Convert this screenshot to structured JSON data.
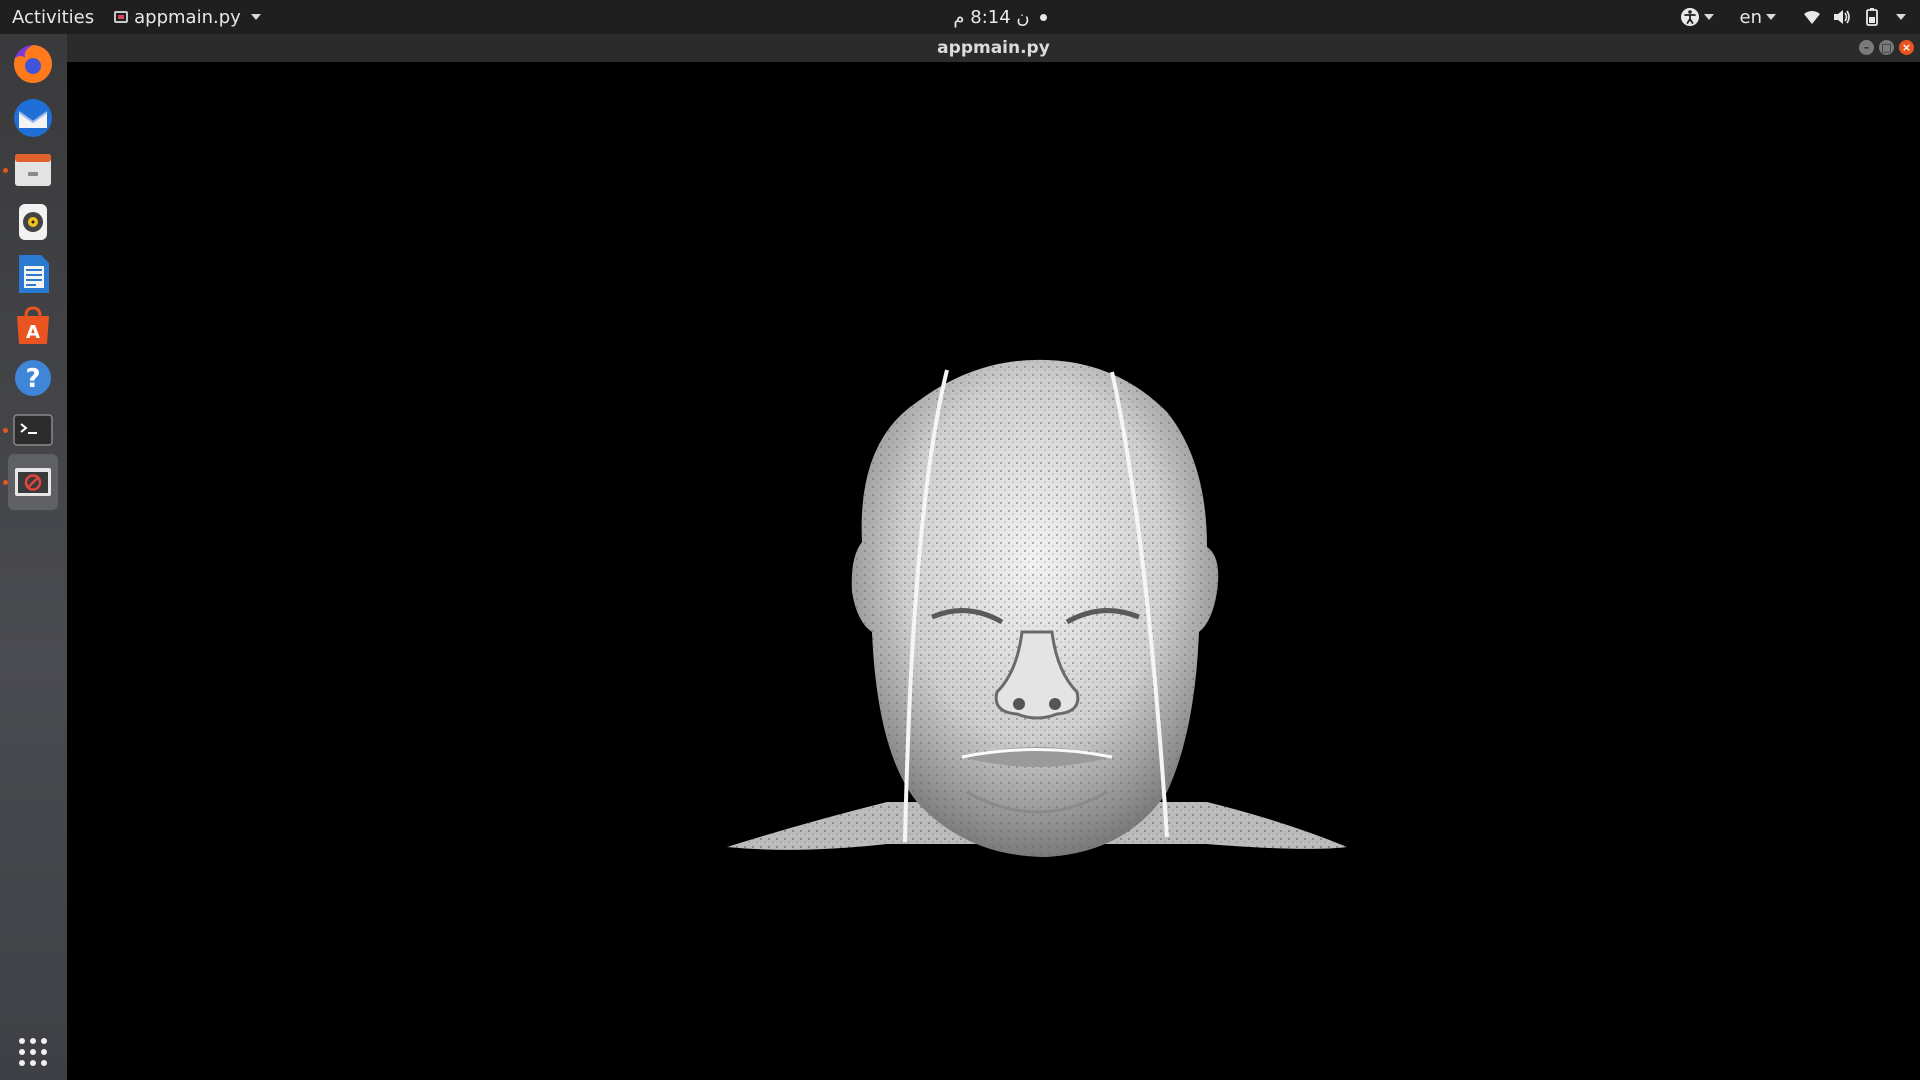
{
  "topbar": {
    "activities": "Activities",
    "app_menu_label": "appmain.py",
    "clock": "ن 8:14 م",
    "language": "en",
    "icons": {
      "accessibility": "accessibility-icon",
      "network": "wifi-icon",
      "volume": "volume-icon",
      "battery": "battery-icon"
    }
  },
  "dock": {
    "items": [
      {
        "name": "Firefox",
        "icon": "firefox-icon",
        "running": false
      },
      {
        "name": "Thunderbird",
        "icon": "thunderbird-icon",
        "running": false
      },
      {
        "name": "Files",
        "icon": "files-icon",
        "running": true
      },
      {
        "name": "Rhythmbox",
        "icon": "rhythmbox-icon",
        "running": false
      },
      {
        "name": "LibreOffice Writer",
        "icon": "writer-icon",
        "running": false
      },
      {
        "name": "Ubuntu Software",
        "icon": "software-icon",
        "running": false
      },
      {
        "name": "Help",
        "icon": "help-icon",
        "running": false
      },
      {
        "name": "Terminal",
        "icon": "terminal-icon",
        "running": true
      },
      {
        "name": "appmain.py",
        "icon": "app-window-icon",
        "running": true
      }
    ],
    "show_apps": "grid-icon"
  },
  "window": {
    "title": "appmain.py",
    "minimize": "–",
    "maximize": "□",
    "close": "×",
    "content": "3D volume rendering of a head (CT scan)"
  },
  "colors": {
    "accent": "#e95420",
    "topbar": "#1f1f1f",
    "canvas": "#000000",
    "render": "#d8d8d8"
  }
}
